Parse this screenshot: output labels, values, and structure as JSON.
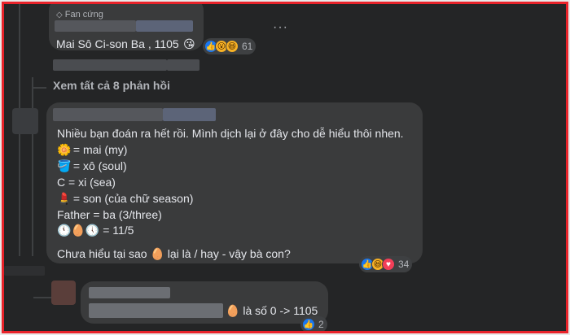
{
  "comment1": {
    "badge_label": "Fan cứng",
    "text": "Mai Sô Ci-son Ba , 1105",
    "emoji": "😘",
    "reaction_count": "61"
  },
  "view_replies": "Xem tất cả 8 phản hồi",
  "comment2": {
    "line1": "Nhiều bạn đoán ra hết rồi. Mình dịch lại ở đây cho dễ hiểu thôi nhen.",
    "row_mai_icon": "🌼",
    "row_mai": "= mai (my)",
    "row_xo_icon": "🪣",
    "row_xo": "= xô (soul)",
    "row_xi": "C = xi (sea)",
    "row_son_icon": "💄",
    "row_son": "= son (của chữ season)",
    "row_ba": "Father = ba (3/three)",
    "row_date_icons": "🕚🥚🕔",
    "row_date": "= 11/5",
    "question_a": "Chưa hiểu tại sao",
    "question_egg": "🥚",
    "question_b": "lại là / hay - vậy bà con?",
    "reaction_count": "34"
  },
  "comment3": {
    "egg": "🥚",
    "text": "là số 0 -> 1105",
    "reaction_count": "2"
  },
  "colors": {
    "background": "#242526",
    "bubble": "#3a3b3c",
    "frame_border": "#e8232a",
    "like_blue": "#1877f2"
  },
  "icons": [
    "diamond-icon",
    "like-icon",
    "haha-icon",
    "wow-icon",
    "love-icon",
    "more-icon"
  ]
}
